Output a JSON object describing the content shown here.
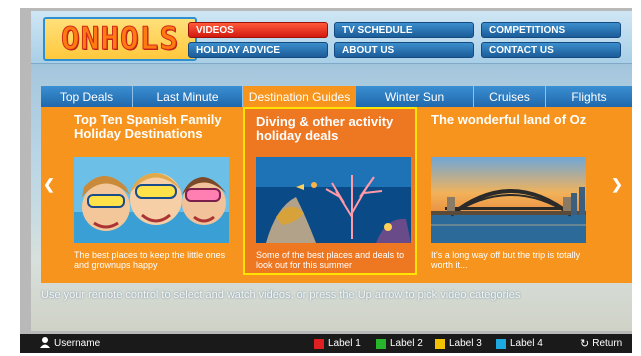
{
  "header": {
    "logo_text": "ONHOLS",
    "nav": [
      {
        "label": "VIDEOS",
        "active": true
      },
      {
        "label": "TV SCHEDULE",
        "active": false
      },
      {
        "label": "COMPETITIONS",
        "active": false
      },
      {
        "label": "HOLIDAY ADVICE",
        "active": false
      },
      {
        "label": "ABOUT US",
        "active": false
      },
      {
        "label": "CONTACT US",
        "active": false
      }
    ]
  },
  "tabs": [
    {
      "label": "Top Deals",
      "active": false
    },
    {
      "label": "Last Minute",
      "active": false
    },
    {
      "label": "Destination Guides",
      "active": true
    },
    {
      "label": "Winter Sun",
      "active": false
    },
    {
      "label": "Cruises",
      "active": false
    },
    {
      "label": "Flights",
      "active": false
    }
  ],
  "cards": [
    {
      "title": "Top Ten Spanish Family Holiday Destinations",
      "description": "The best places to keep the little ones and grownups happy",
      "image": "children-snorkel-photo",
      "selected": false
    },
    {
      "title": "Diving & other activity holiday deals",
      "description": "Some of the best places and deals to look out for this summer",
      "image": "coral-reef-photo",
      "selected": true
    },
    {
      "title": "The wonderful land of Oz",
      "description": "It's a long way off but the trip is totally worth it...",
      "image": "sydney-harbour-bridge-photo",
      "selected": false
    }
  ],
  "hint": "Use your remote control to select and watch videos, or press the Up arrow to pick video categories",
  "footer": {
    "username": "Username",
    "labels": [
      {
        "label": "Label 1",
        "color": "#e02020"
      },
      {
        "label": "Label 2",
        "color": "#29b52b"
      },
      {
        "label": "Label 3",
        "color": "#f2c200"
      },
      {
        "label": "Label 4",
        "color": "#1fa8e0"
      }
    ],
    "return_label": "Return"
  },
  "colors": {
    "accent": "#f7941d",
    "nav_active": "#d21a0f",
    "tab_bar": "#1f68ab",
    "selected_border": "#ffe400"
  }
}
